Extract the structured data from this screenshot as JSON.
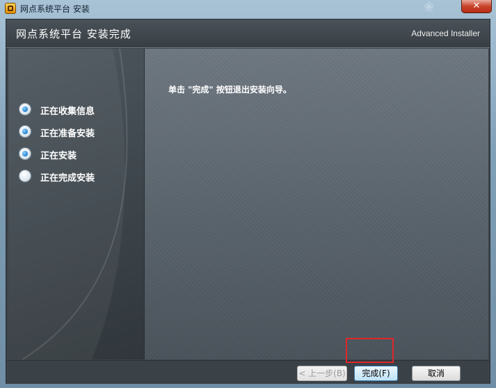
{
  "window": {
    "title": "网点系统平台 安装",
    "close_glyph": "✕"
  },
  "header": {
    "title": "网点系统平台 安装完成",
    "brand": "Advanced Installer"
  },
  "sidebar": {
    "steps": [
      {
        "label": "正在收集信息",
        "state": "done"
      },
      {
        "label": "正在准备安装",
        "state": "done"
      },
      {
        "label": "正在安装",
        "state": "done"
      },
      {
        "label": "正在完成安装",
        "state": "current"
      }
    ]
  },
  "content": {
    "message": "单击 \"完成\" 按钮退出安装向导。"
  },
  "footer": {
    "back_label": "< 上一步(B)",
    "finish_label": "完成(F)",
    "cancel_label": "取消"
  },
  "colors": {
    "highlight": "#e0262b",
    "accent": "#1f7fd0"
  }
}
